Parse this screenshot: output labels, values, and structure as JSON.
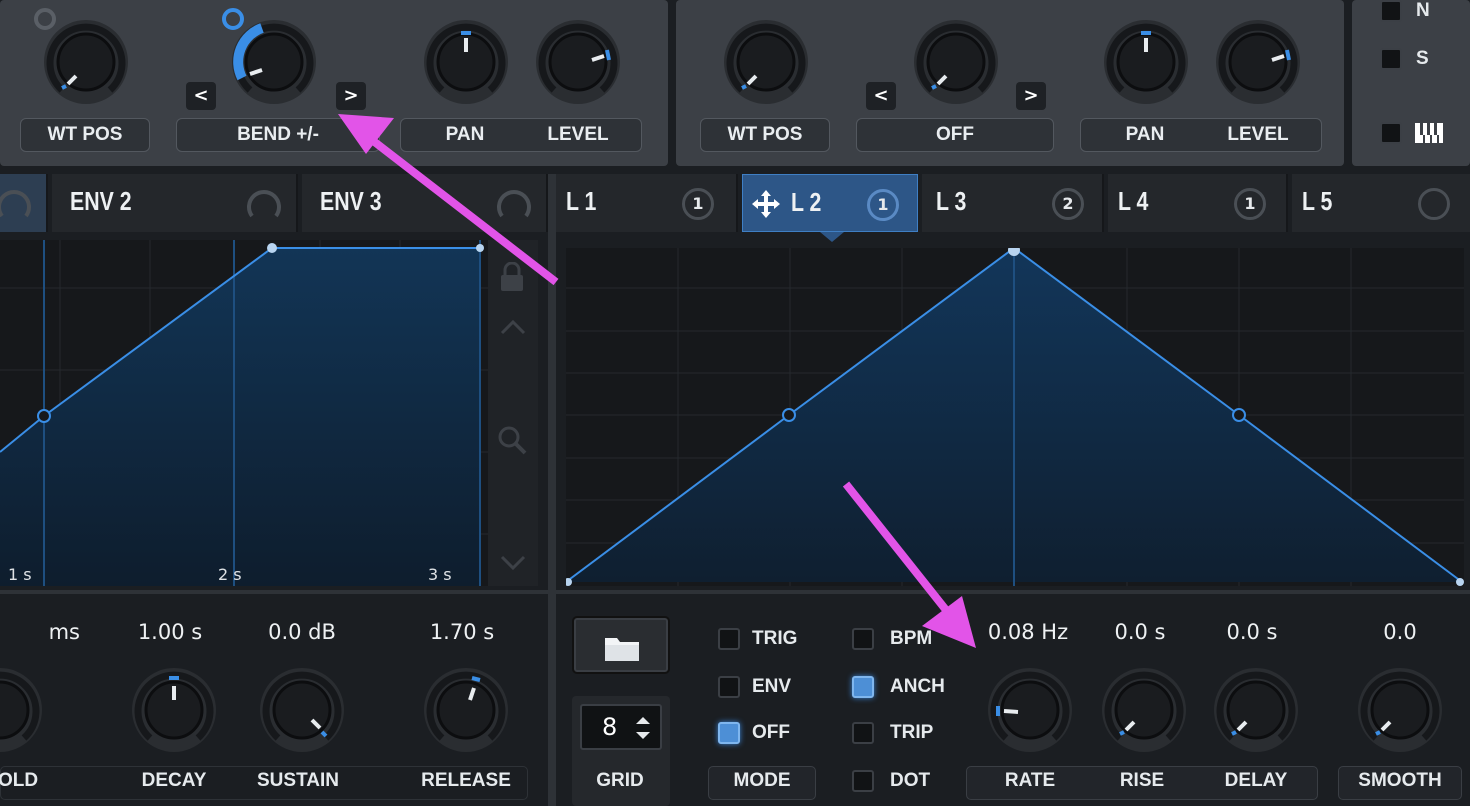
{
  "osc_a": {
    "knobs": [
      {
        "label": "WT POS"
      },
      {
        "label": "BEND +/-"
      },
      {
        "label": "PAN"
      },
      {
        "label": "LEVEL"
      }
    ]
  },
  "osc_b": {
    "knobs": [
      {
        "label": "WT POS"
      },
      {
        "label": "OFF"
      },
      {
        "label": "PAN"
      },
      {
        "label": "LEVEL"
      }
    ]
  },
  "nav": {
    "prev": "<",
    "next": ">"
  },
  "side": {
    "n": "N",
    "s": "S"
  },
  "env_tabs": [
    {
      "label": "ENV 2"
    },
    {
      "label": "ENV 3"
    }
  ],
  "lfo_tabs": [
    {
      "label": "L 1",
      "badge": "1"
    },
    {
      "label": "L 2",
      "badge": "1"
    },
    {
      "label": "L 3",
      "badge": "2"
    },
    {
      "label": "L 4",
      "badge": "1"
    },
    {
      "label": "L 5",
      "badge": ""
    }
  ],
  "env_graph": {
    "time_labels": [
      "1 s",
      "2 s",
      "3 s"
    ]
  },
  "env_params": [
    {
      "value": "ms",
      "label": "OLD"
    },
    {
      "value": "1.00 s",
      "label": "DECAY"
    },
    {
      "value": "0.0 dB",
      "label": "SUSTAIN"
    },
    {
      "value": "1.70 s",
      "label": "RELEASE"
    }
  ],
  "lfo_controls": {
    "grid": {
      "value": "8",
      "label": "GRID"
    },
    "mode": {
      "label": "MODE",
      "options": [
        {
          "label": "TRIG",
          "on": false
        },
        {
          "label": "ENV",
          "on": false
        },
        {
          "label": "OFF",
          "on": true
        }
      ]
    },
    "flags": [
      {
        "label": "BPM",
        "on": false
      },
      {
        "label": "ANCH",
        "on": true
      },
      {
        "label": "TRIP",
        "on": false
      },
      {
        "label": "DOT",
        "on": false
      }
    ]
  },
  "lfo_params": [
    {
      "value": "0.08 Hz",
      "label": "RATE"
    },
    {
      "value": "0.0 s",
      "label": "RISE"
    },
    {
      "value": "0.0 s",
      "label": "DELAY"
    },
    {
      "value": "0.0",
      "label": "SMOOTH"
    }
  ],
  "colors": {
    "accent": "#3a8ee6",
    "annotation": "#e254e8",
    "panel": "#3c4046",
    "background": "#1b1e22"
  }
}
